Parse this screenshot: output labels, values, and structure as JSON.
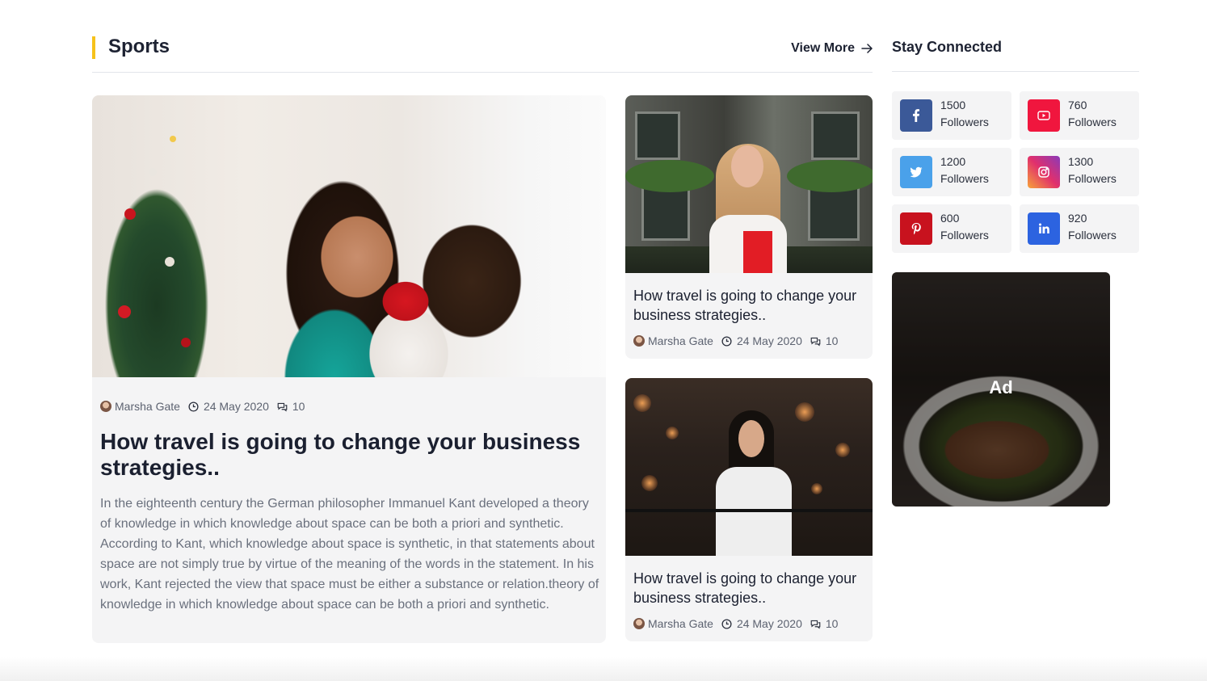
{
  "section": {
    "title": "Sports",
    "view_more": "View More"
  },
  "sidebar": {
    "title": "Stay Connected",
    "socials": [
      {
        "network": "facebook",
        "icon": "facebook-icon",
        "count": "1500",
        "label": "Followers",
        "color": "#3b5998"
      },
      {
        "network": "youtube",
        "icon": "youtube-icon",
        "count": "760",
        "label": "Followers",
        "color": "#f0163e"
      },
      {
        "network": "twitter",
        "icon": "twitter-icon",
        "count": "1200",
        "label": "Followers",
        "color": "#4aa1ea"
      },
      {
        "network": "instagram",
        "icon": "instagram-icon",
        "count": "1300",
        "label": "Followers",
        "color": "#d62976"
      },
      {
        "network": "pinterest",
        "icon": "pinterest-icon",
        "count": "600",
        "label": "Followers",
        "color": "#c8121e"
      },
      {
        "network": "linkedin",
        "icon": "linkedin-icon",
        "count": "920",
        "label": "Followers",
        "color": "#2c63e0"
      }
    ],
    "ad_label": "Ad"
  },
  "main_article": {
    "author": "Marsha Gate",
    "date": "24 May 2020",
    "comments": "10",
    "title": "How travel is going to change your business strategies..",
    "excerpt": "In the eighteenth century the German philosopher Immanuel Kant developed a theory of knowledge in which knowledge about space can be both a priori and synthetic. According to Kant, which knowledge about space is synthetic, in that statements about space are not simply true by virtue of the meaning of the words in the statement. In his work, Kant rejected the view that space must be either a substance or relation.theory of knowledge in which knowledge about space can be both a priori and synthetic."
  },
  "side_articles": [
    {
      "title": "How travel is going to change your business strategies..",
      "author": "Marsha Gate",
      "date": "24 May 2020",
      "comments": "10"
    },
    {
      "title": "How travel is going to change your business strategies..",
      "author": "Marsha Gate",
      "date": "24 May 2020",
      "comments": "10"
    }
  ],
  "colors": {
    "accent_bar": "#f6c21b",
    "card_bg": "#f4f4f5",
    "text_dark": "#1b2030",
    "text_muted": "#6a707d"
  }
}
